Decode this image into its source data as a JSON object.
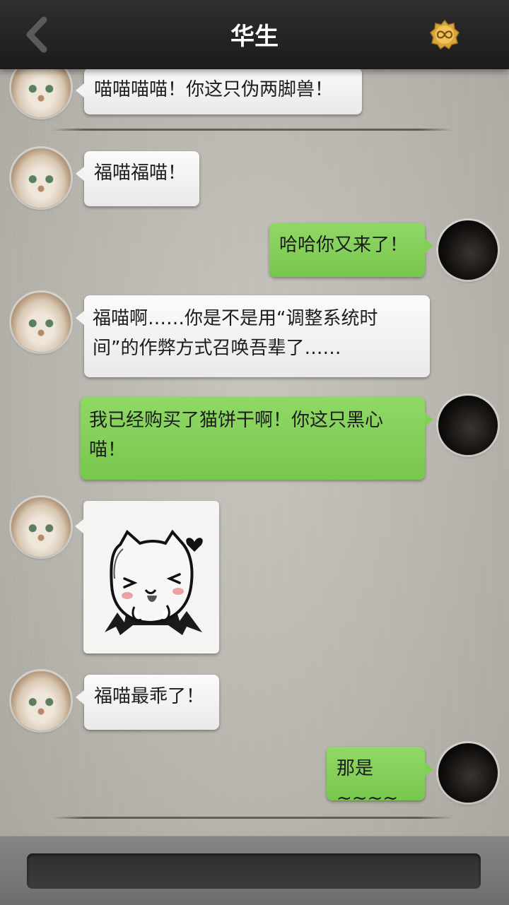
{
  "header": {
    "title": "华生",
    "back_icon": "chevron-left-icon",
    "badge_icon": "infinity-badge-icon"
  },
  "messages": [
    {
      "side": "in",
      "text": "喵喵喵喵！你这只伪两脚兽！"
    },
    {
      "side": "in",
      "text": "福喵福喵！"
    },
    {
      "side": "out",
      "text": "哈哈你又来了！"
    },
    {
      "side": "in",
      "text": "福喵啊……你是不是用“调整系统时间”的作弊方式召唤吾辈了……"
    },
    {
      "side": "out",
      "text": "我已经购买了猫饼干啊！你这只黑心喵！"
    },
    {
      "side": "in",
      "type": "sticker",
      "sticker": "vampire-cat-sticker"
    },
    {
      "side": "in",
      "text": "福喵最乖了！"
    },
    {
      "side": "out",
      "text": "那是~~~~"
    }
  ],
  "input": {
    "value": "",
    "placeholder": ""
  },
  "colors": {
    "topbar": "#232323",
    "incoming_bubble": "#f3f3f3",
    "outgoing_bubble": "#82cf58",
    "input_bar": "#7a7a7a"
  }
}
